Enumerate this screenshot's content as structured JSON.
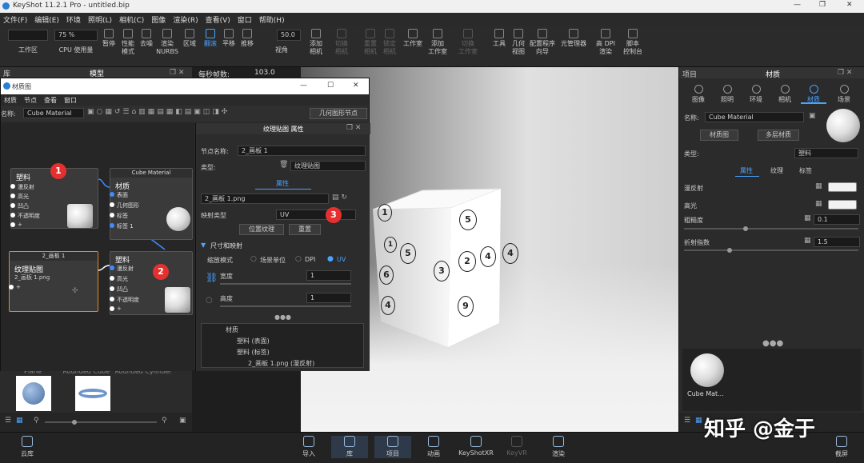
{
  "app": {
    "title": "KeyShot 11.2.1 Pro  - untitled.bip"
  },
  "menu": [
    "文件(F)",
    "编辑(E)",
    "环境",
    "照明(L)",
    "相机(C)",
    "图像",
    "渲染(R)",
    "查看(V)",
    "窗口",
    "帮助(H)"
  ],
  "toolbar": {
    "zoom": "75 %",
    "fov": "50.0",
    "items": [
      "工作区",
      "CPU 使用量",
      "暂停",
      "性能\n模式",
      "去噪",
      "渲染\nNURBS",
      "区域",
      "翻滚",
      "平移",
      "推移",
      "视角",
      "添加\n相机",
      "切换\n相机",
      "重置\n相机",
      "锁定\n相机",
      "工作室",
      "添加\n工作室",
      "切换\n工作室",
      "工具",
      "几何\n视图",
      "配置程序\n向导",
      "光管理器",
      "高 DPI\n渲染",
      "脚本\n控制台"
    ]
  },
  "left_panel": {
    "tabs": [
      "库",
      "模型"
    ],
    "fps_label": "每秒帧数:",
    "fps_value": "103.0",
    "thumbs": [
      "Plane",
      "Rounded Cube",
      "Rounded Cylinder"
    ]
  },
  "material_window": {
    "title": "材质图",
    "menu": [
      "材质",
      "节点",
      "查看",
      "窗口"
    ],
    "name_label": "名称:",
    "name_value": "Cube Material",
    "geom_btn": "几何图形节点",
    "nodes": {
      "diffuse_node": {
        "title": "塑料",
        "ports": [
          "漫反射",
          "高光",
          "凹凸",
          "不透明度",
          "+"
        ]
      },
      "cube_material": {
        "title": "Cube Material",
        "sub": "材质",
        "ports": [
          "表面",
          "几何图形",
          "标签",
          "标签 1"
        ]
      },
      "texture_node": {
        "header": "2_画板 1",
        "title": "纹理贴图",
        "sub": "2_画板 1.png",
        "port": "+"
      },
      "plastic_node": {
        "title": "塑料",
        "ports": [
          "漫反射",
          "高光",
          "凹凸",
          "不透明度",
          "+"
        ]
      }
    },
    "badges": [
      "1",
      "2",
      "3"
    ],
    "props": {
      "header": "纹理贴图 属性",
      "node_name_label": "节点名称:",
      "node_name": "2_画板 1",
      "type_label": "类型:",
      "type_value": "纹理贴图",
      "tab": "属性",
      "file": "2_画板 1.png",
      "map_type_label": "映射类型",
      "map_type": "UV",
      "position_btn": "位置纹理",
      "reset_btn": "重置",
      "section": "尺寸和映射",
      "scale_mode_label": "缩放模式",
      "scale_options": [
        "场景单位",
        "DPI",
        "UV"
      ],
      "width_label": "宽度",
      "width": "1",
      "height_label": "高度",
      "height": "1",
      "tree": [
        "材质",
        "塑料 (表面)",
        "塑料 (标签)",
        "2_画板 1.png (漫反射)"
      ]
    }
  },
  "die_numbers": [
    "1",
    "5",
    "5",
    "2",
    "4",
    "4",
    "3",
    "6",
    "9",
    "4",
    "1"
  ],
  "right_panel": {
    "tabs_top": [
      "项目",
      "材质"
    ],
    "tabs": [
      "图像",
      "照明",
      "环境",
      "相机",
      "材质",
      "场景"
    ],
    "name_label": "名称:",
    "name_value": "Cube Material",
    "btn_graph": "材质图",
    "btn_multi": "多层材质",
    "type_label": "类型:",
    "type_value": "塑料",
    "subtabs": [
      "属性",
      "纹理",
      "标签"
    ],
    "rows": [
      {
        "label": "漫反射"
      },
      {
        "label": "高光"
      },
      {
        "label": "粗糙度",
        "value": "0.1"
      },
      {
        "label": "折射指数",
        "value": "1.5"
      }
    ],
    "thumb_label": "Cube Mat..."
  },
  "bottom": [
    "云库",
    "导入",
    "库",
    "项目",
    "动画",
    "KeyShotXR",
    "KeyVR",
    "渲染",
    "截屏"
  ],
  "watermark": "知乎 @金于"
}
